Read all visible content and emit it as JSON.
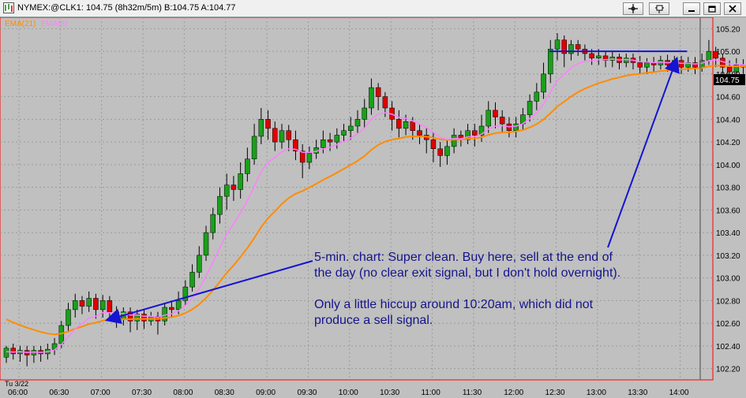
{
  "window": {
    "title": "NYMEX:@CLK1: 104.75 (8h32m/5m)  B:104.75 A:104.77",
    "buttons": [
      "crosshair-button",
      "pin-button",
      "minimize-button",
      "restore-button",
      "close-button"
    ]
  },
  "legend": {
    "ema_label": "EMA(21)",
    "ema2_label": "EMA(8)",
    "ema_color": "#ff8c00",
    "ema2_color": "#ff80ff"
  },
  "annotation": {
    "paragraph1": "5-min. chart: Super clean. Buy here, sell at the end of the day (no clear exit signal, but I don't hold overnight).",
    "paragraph2": "Only a little hiccup around 10:20am, which did not produce a sell signal."
  },
  "colors": {
    "background": "#c0c0c0",
    "grid": "#9a9a9a",
    "up_candle": "#1aa01a",
    "down_candle": "#e00000",
    "wick": "#000000",
    "ema21": "#ff8c00",
    "ema8": "#ff80ff",
    "arrow": "#1414d2",
    "resistance": "#1414d2",
    "last_price_bg": "#000000",
    "last_price_fg": "#ffffff"
  },
  "chart_data": {
    "type": "candlestick",
    "symbol": "NYMEX:@CLK1",
    "interval": "5m",
    "date_label": "Tu 3/22",
    "x_tick_labels": [
      "06:00",
      "06:30",
      "07:00",
      "07:30",
      "08:00",
      "08:30",
      "09:00",
      "09:30",
      "10:00",
      "10:30",
      "11:00",
      "11:30",
      "12:00",
      "12:30",
      "13:00",
      "13:30",
      "14:00"
    ],
    "y_tick_labels": [
      "105.20",
      "105.00",
      "104.80",
      "104.60",
      "104.40",
      "104.20",
      "104.00",
      "103.80",
      "103.60",
      "103.40",
      "103.20",
      "103.00",
      "102.80",
      "102.60",
      "102.40",
      "102.20"
    ],
    "ylim": [
      102.1,
      105.3
    ],
    "last_price_label": "104.75",
    "grid": true,
    "start_time": "06:00",
    "candles": [
      [
        102.3,
        102.38,
        102.25,
        102.4
      ],
      [
        102.38,
        102.33,
        102.28,
        102.42
      ],
      [
        102.33,
        102.36,
        102.26,
        102.4
      ],
      [
        102.36,
        102.32,
        102.22,
        102.4
      ],
      [
        102.32,
        102.36,
        102.25,
        102.4
      ],
      [
        102.36,
        102.33,
        102.26,
        102.4
      ],
      [
        102.33,
        102.37,
        102.28,
        102.42
      ],
      [
        102.37,
        102.42,
        102.32,
        102.47
      ],
      [
        102.42,
        102.58,
        102.38,
        102.62
      ],
      [
        102.58,
        102.72,
        102.52,
        102.78
      ],
      [
        102.72,
        102.8,
        102.65,
        102.86
      ],
      [
        102.8,
        102.75,
        102.68,
        102.84
      ],
      [
        102.75,
        102.82,
        102.7,
        102.88
      ],
      [
        102.82,
        102.72,
        102.64,
        102.86
      ],
      [
        102.72,
        102.8,
        102.65,
        102.85
      ],
      [
        102.8,
        102.7,
        102.62,
        102.84
      ],
      [
        102.7,
        102.64,
        102.56,
        102.75
      ],
      [
        102.64,
        102.7,
        102.58,
        102.74
      ],
      [
        102.7,
        102.62,
        102.52,
        102.74
      ],
      [
        102.62,
        102.68,
        102.54,
        102.72
      ],
      [
        102.68,
        102.62,
        102.55,
        102.72
      ],
      [
        102.62,
        102.66,
        102.58,
        102.7
      ],
      [
        102.66,
        102.62,
        102.5,
        102.7
      ],
      [
        102.62,
        102.74,
        102.58,
        102.78
      ],
      [
        102.74,
        102.72,
        102.66,
        102.8
      ],
      [
        102.72,
        102.8,
        102.68,
        102.88
      ],
      [
        102.8,
        102.92,
        102.76,
        102.98
      ],
      [
        102.92,
        103.05,
        102.88,
        103.12
      ],
      [
        103.05,
        103.2,
        103.0,
        103.28
      ],
      [
        103.2,
        103.4,
        103.15,
        103.46
      ],
      [
        103.4,
        103.56,
        103.34,
        103.62
      ],
      [
        103.56,
        103.72,
        103.48,
        103.8
      ],
      [
        103.72,
        103.82,
        103.6,
        103.92
      ],
      [
        103.82,
        103.78,
        103.68,
        103.9
      ],
      [
        103.78,
        103.92,
        103.7,
        104.02
      ],
      [
        103.92,
        104.05,
        103.85,
        104.15
      ],
      [
        104.05,
        104.25,
        104.0,
        104.36
      ],
      [
        104.25,
        104.4,
        104.18,
        104.5
      ],
      [
        104.4,
        104.32,
        104.22,
        104.48
      ],
      [
        104.32,
        104.2,
        104.12,
        104.38
      ],
      [
        104.2,
        104.3,
        104.14,
        104.36
      ],
      [
        104.3,
        104.22,
        104.12,
        104.35
      ],
      [
        104.22,
        104.12,
        104.04,
        104.3
      ],
      [
        104.12,
        104.02,
        103.88,
        104.18
      ],
      [
        104.02,
        104.1,
        103.96,
        104.16
      ],
      [
        104.1,
        104.15,
        104.05,
        104.22
      ],
      [
        104.15,
        104.22,
        104.1,
        104.3
      ],
      [
        104.22,
        104.2,
        104.12,
        104.28
      ],
      [
        104.2,
        104.26,
        104.14,
        104.32
      ],
      [
        104.26,
        104.3,
        104.2,
        104.36
      ],
      [
        104.3,
        104.34,
        104.22,
        104.42
      ],
      [
        104.34,
        104.4,
        104.28,
        104.48
      ],
      [
        104.4,
        104.5,
        104.32,
        104.58
      ],
      [
        104.5,
        104.68,
        104.44,
        104.76
      ],
      [
        104.68,
        104.6,
        104.48,
        104.72
      ],
      [
        104.6,
        104.5,
        104.42,
        104.64
      ],
      [
        104.5,
        104.4,
        104.3,
        104.56
      ],
      [
        104.4,
        104.32,
        104.24,
        104.48
      ],
      [
        104.32,
        104.38,
        104.26,
        104.44
      ],
      [
        104.38,
        104.3,
        104.22,
        104.42
      ],
      [
        104.3,
        104.26,
        104.18,
        104.36
      ],
      [
        104.26,
        104.22,
        104.1,
        104.32
      ],
      [
        104.22,
        104.14,
        104.02,
        104.28
      ],
      [
        104.14,
        104.08,
        103.98,
        104.2
      ],
      [
        104.08,
        104.16,
        104.0,
        104.22
      ],
      [
        104.16,
        104.26,
        104.1,
        104.32
      ],
      [
        104.26,
        104.22,
        104.16,
        104.3
      ],
      [
        104.22,
        104.3,
        104.18,
        104.36
      ],
      [
        104.3,
        104.26,
        104.16,
        104.36
      ],
      [
        104.26,
        104.34,
        104.2,
        104.44
      ],
      [
        104.34,
        104.48,
        104.28,
        104.56
      ],
      [
        104.48,
        104.42,
        104.32,
        104.55
      ],
      [
        104.42,
        104.36,
        104.28,
        104.48
      ],
      [
        104.36,
        104.3,
        104.24,
        104.42
      ],
      [
        104.3,
        104.36,
        104.24,
        104.42
      ],
      [
        104.36,
        104.44,
        104.3,
        104.5
      ],
      [
        104.44,
        104.56,
        104.38,
        104.62
      ],
      [
        104.56,
        104.64,
        104.48,
        104.72
      ],
      [
        104.64,
        104.8,
        104.58,
        104.9
      ],
      [
        104.8,
        105.02,
        104.72,
        105.1
      ],
      [
        105.02,
        105.1,
        104.92,
        105.16
      ],
      [
        105.1,
        104.98,
        104.86,
        105.14
      ],
      [
        104.98,
        105.06,
        104.92,
        105.1
      ],
      [
        105.06,
        105.02,
        104.96,
        105.1
      ],
      [
        105.02,
        104.98,
        104.92,
        105.06
      ],
      [
        104.98,
        104.94,
        104.88,
        105.02
      ],
      [
        104.94,
        104.96,
        104.88,
        105.02
      ],
      [
        104.96,
        104.92,
        104.86,
        105.0
      ],
      [
        104.92,
        104.95,
        104.86,
        105.0
      ],
      [
        104.95,
        104.9,
        104.84,
        104.98
      ],
      [
        104.9,
        104.94,
        104.86,
        104.98
      ],
      [
        104.94,
        104.9,
        104.84,
        104.98
      ],
      [
        104.9,
        104.86,
        104.8,
        104.96
      ],
      [
        104.86,
        104.9,
        104.8,
        104.94
      ],
      [
        104.9,
        104.88,
        104.82,
        104.95
      ],
      [
        104.88,
        104.92,
        104.84,
        104.96
      ],
      [
        104.92,
        104.88,
        104.82,
        104.97
      ],
      [
        104.88,
        104.92,
        104.84,
        104.96
      ],
      [
        104.92,
        104.86,
        104.8,
        104.96
      ],
      [
        104.86,
        104.9,
        104.82,
        104.95
      ],
      [
        104.9,
        104.86,
        104.8,
        104.95
      ],
      [
        104.86,
        104.92,
        104.82,
        104.98
      ],
      [
        104.92,
        105.0,
        104.88,
        105.1
      ],
      [
        105.0,
        104.94,
        104.86,
        105.04
      ],
      [
        104.94,
        104.86,
        104.8,
        104.98
      ],
      [
        104.86,
        104.82,
        104.76,
        104.92
      ],
      [
        104.82,
        104.88,
        104.78,
        104.94
      ],
      [
        104.88,
        104.86,
        104.8,
        104.93
      ],
      [
        104.86,
        104.82,
        104.76,
        104.92
      ],
      [
        104.82,
        104.88,
        104.78,
        104.94
      ],
      [
        104.88,
        104.86,
        104.8,
        104.94
      ]
    ],
    "ema21_label": "EMA(21)",
    "ema8_label": "EMA(8)",
    "resistance_price": 105.0,
    "resistance_from": "12:25",
    "resistance_to": "14:05",
    "arrow1_tip": {
      "time": "07:00",
      "price": 102.63
    },
    "arrow1_tail_text": "annotation",
    "arrow2_tip": {
      "time": "13:55",
      "price": 104.97
    }
  }
}
